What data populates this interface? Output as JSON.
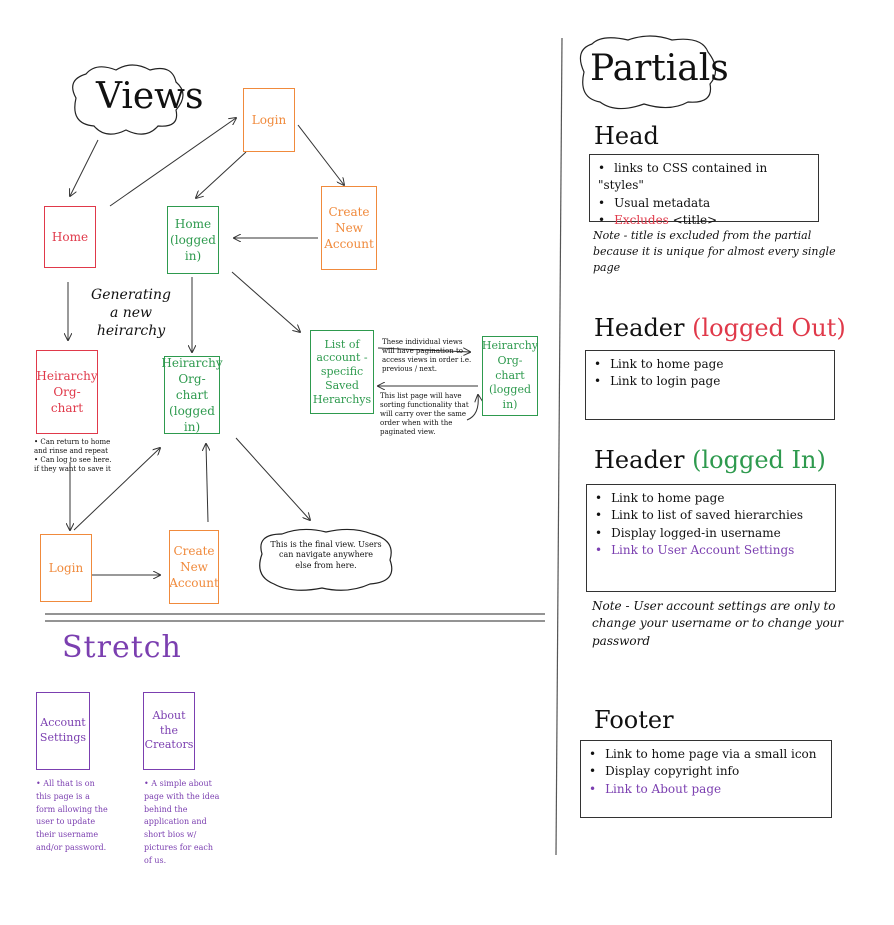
{
  "views_title": "Views",
  "nodes": {
    "login_top": "Login",
    "home": "Home",
    "home_logged_in": [
      "Home",
      "(logged",
      "in)"
    ],
    "create_account_top": [
      "Create",
      "New",
      "Account"
    ],
    "generating_note": [
      "Generating",
      "a new",
      "heirarchy"
    ],
    "hierarchy_red": [
      "Heirarchy",
      "Org-chart"
    ],
    "hierarchy_green": [
      "Heirarchy",
      "Org-chart",
      "(logged",
      "in)"
    ],
    "saved_list": [
      "List of",
      "account -",
      "specific",
      "Saved",
      "Herarchys"
    ],
    "hierarchy_right": [
      "Heirarchy",
      "Org- chart",
      "(logged",
      "in)"
    ],
    "login_bottom": "Login",
    "create_account_bottom": [
      "Create",
      "New",
      "Account"
    ]
  },
  "notes": {
    "pagination": "These individual views will have pagination to access views in order i.e. previous / next.",
    "sorting": "This list page will have sorting functionality that will carry over the same order when with the paginated view.",
    "red_bullets": [
      "Can return to home and rinse and repeat",
      "Can log to see here. if they want to save it"
    ],
    "final_view": "This is the final view. Users can navigate anywhere else from here."
  },
  "stretch": {
    "title": "Stretch",
    "account_settings": [
      "Account",
      "Settings"
    ],
    "about_creators": [
      "About",
      "the",
      "Creators"
    ],
    "account_note": "All that is on this page is a form allowing the user to update their username and/or password.",
    "about_note": "A simple about page with the idea behind the application and short bios w/ pictures for each of us."
  },
  "partials": {
    "title": "Partials",
    "head": {
      "title": "Head",
      "items": [
        "links to CSS contained in \"styles\"",
        "Usual metadata"
      ],
      "excludes_word": "Excludes",
      "excludes_rest": "<title>",
      "note": "Note - title is excluded from the partial because it is unique for almost every single page"
    },
    "header_out": {
      "title_black": "Header",
      "title_colored": "(logged Out)",
      "items": [
        "Link to home page",
        "Link to login page"
      ]
    },
    "header_in": {
      "title_black": "Header",
      "title_colored": "(logged In)",
      "items": [
        "Link to home page",
        "Link to list of saved hierarchies",
        "Display logged-in username"
      ],
      "purple_item": "Link to User Account Settings",
      "note": "Note - User account settings are only to change your username or to change your password"
    },
    "footer": {
      "title": "Footer",
      "items": [
        "Link to home page via a small icon",
        "Display copyright info"
      ],
      "purple_item": "Link to About page"
    }
  },
  "colors": {
    "red": "#e0394a",
    "orange": "#f08a3c",
    "green": "#2e9a4e",
    "purple": "#7b3fb0"
  }
}
